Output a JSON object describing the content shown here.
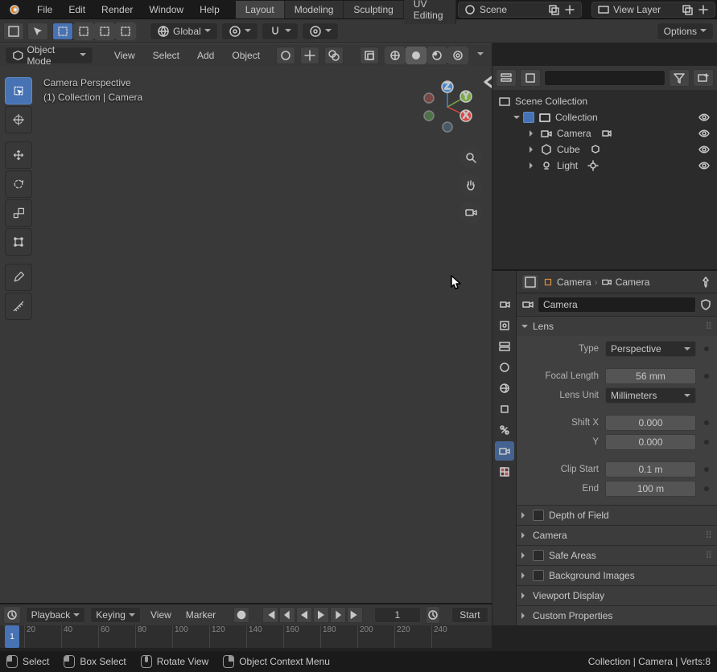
{
  "topbar": {
    "menus": [
      "File",
      "Edit",
      "Render",
      "Window",
      "Help"
    ],
    "workspaces": [
      {
        "label": "Layout",
        "active": true
      },
      {
        "label": "Modeling",
        "active": false
      },
      {
        "label": "Sculpting",
        "active": false
      },
      {
        "label": "UV Editing",
        "active": false
      }
    ],
    "scene_label": "Scene",
    "viewlayer_label": "View Layer"
  },
  "header3d": {
    "orientation": "Global",
    "options": "Options"
  },
  "toolbar3": {
    "mode": "Object Mode",
    "view": "View",
    "select": "Select",
    "add": "Add",
    "object": "Object"
  },
  "viewport": {
    "title": "Camera Perspective",
    "subtitle": "(1) Collection | Camera"
  },
  "outliner": {
    "root": "Scene Collection",
    "collection": "Collection",
    "items": [
      {
        "label": "Camera",
        "icon": "camera"
      },
      {
        "label": "Cube",
        "icon": "mesh"
      },
      {
        "label": "Light",
        "icon": "light"
      }
    ]
  },
  "props": {
    "crumb1": "Camera",
    "crumb2": "Camera",
    "name": "Camera",
    "lens_title": "Lens",
    "type_label": "Type",
    "type_value": "Perspective",
    "fl_label": "Focal Length",
    "fl_value": "56 mm",
    "lu_label": "Lens Unit",
    "lu_value": "Millimeters",
    "sx_label": "Shift X",
    "sx_value": "0.000",
    "sy_label": "Y",
    "sy_value": "0.000",
    "cs_label": "Clip Start",
    "cs_value": "0.1 m",
    "ce_label": "End",
    "ce_value": "100 m",
    "panels": [
      "Depth of Field",
      "Camera",
      "Safe Areas",
      "Background Images",
      "Viewport Display",
      "Custom Properties"
    ]
  },
  "timeline": {
    "playback": "Playback",
    "keying": "Keying",
    "view": "View",
    "marker": "Marker",
    "frame": "1",
    "start": "Start",
    "ticks": [
      "20",
      "40",
      "60",
      "80",
      "100",
      "120",
      "140",
      "160",
      "180",
      "200",
      "220",
      "240"
    ]
  },
  "status": {
    "select": "Select",
    "box": "Box Select",
    "rotate": "Rotate View",
    "ctx": "Object Context Menu",
    "stats": "Collection | Camera | Verts:8"
  }
}
